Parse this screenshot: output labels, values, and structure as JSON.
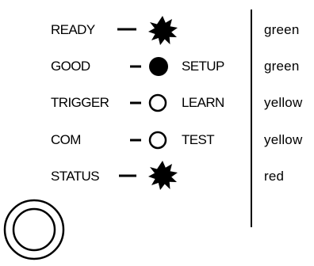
{
  "indicators": [
    {
      "label": "READY",
      "led": "star",
      "mode": "",
      "color": "green"
    },
    {
      "label": "GOOD",
      "led": "filled",
      "mode": "SETUP",
      "color": "green"
    },
    {
      "label": "TRIGGER",
      "led": "open",
      "mode": "LEARN",
      "color": "yellow"
    },
    {
      "label": "COM",
      "led": "open",
      "mode": "TEST",
      "color": "yellow"
    },
    {
      "label": "STATUS",
      "led": "star",
      "mode": "",
      "color": "red"
    }
  ],
  "button": {
    "name": "push-button"
  }
}
